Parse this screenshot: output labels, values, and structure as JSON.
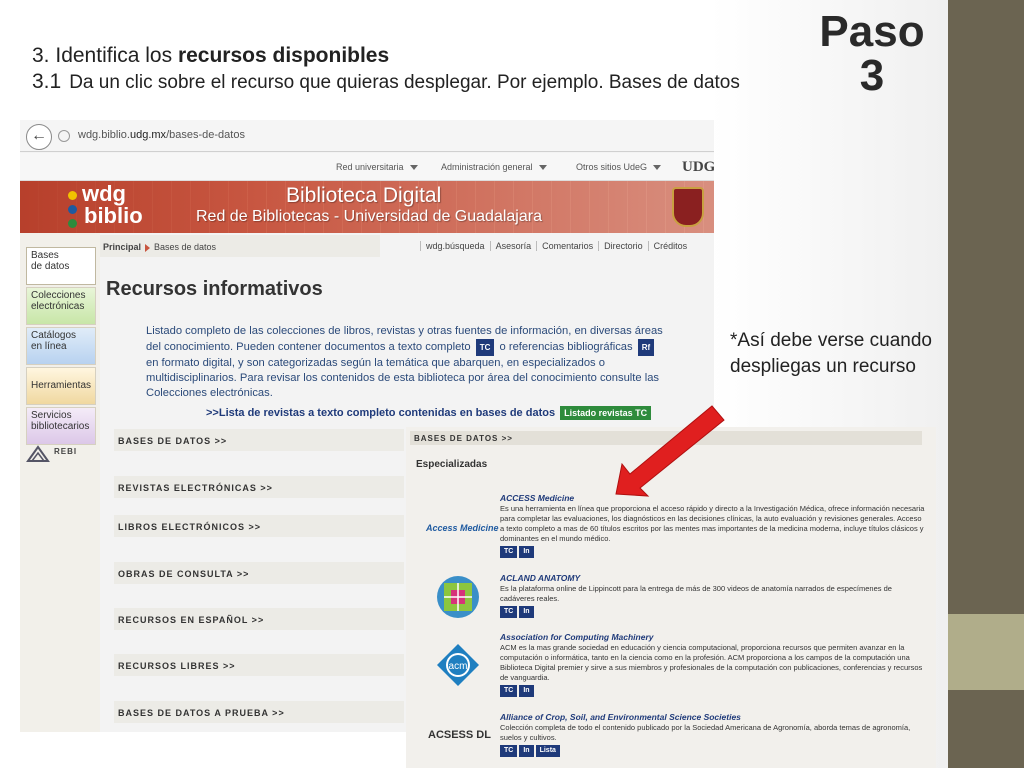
{
  "slide": {
    "paso_label": "Paso",
    "paso_number": "3",
    "step1_number": "3.",
    "step1_prefix": "Identifica los ",
    "step1_bold": "recursos disponibles",
    "step2_number": "3.1",
    "step2_text": "Da un clic sobre el recurso que quieras desplegar. Por ejemplo. Bases de datos",
    "note_text": "*Así debe verse cuando despliegas un recurso",
    "colors": {
      "band_dark": "#6b6451",
      "band_light": "#b0ad8a",
      "arrow": "#e01f1f"
    }
  },
  "browser": {
    "back_icon": "back-arrow-icon",
    "url_host": "wdg.biblio.",
    "url_domain": "udg.mx",
    "url_path": "/bases-de-datos",
    "top_nav": [
      "Red universitaria",
      "Administración general",
      "Otros sitios UdeG"
    ],
    "udg_logo": "UDG",
    "banner_logo_line1": "wdg",
    "banner_logo_line2": "biblio",
    "banner_title": "Biblioteca Digital",
    "banner_subtitle": "Red de Bibliotecas - Universidad de Guadalajara",
    "sidebar": [
      {
        "label": "Bases\nde datos"
      },
      {
        "label": "Colecciones\nelectrónicas"
      },
      {
        "label": "Catálogos\nen línea"
      },
      {
        "label": "Herramientas"
      },
      {
        "label": "Servicios\nbibliotecarios"
      }
    ],
    "rebi_label": "REBI",
    "breadcrumb_home": "Principal",
    "breadcrumb_current": "Bases de datos",
    "util_links": [
      "wdg.búsqueda",
      "Asesoría",
      "Comentarios",
      "Directorio",
      "Créditos"
    ],
    "page_title": "Recursos informativos",
    "intro_part1": "Listado completo de las colecciones de libros, revistas y otras fuentes de información, en diversas áreas del conocimiento. Pueden contener documentos a texto completo",
    "intro_tc": "TC",
    "intro_part2": "o referencias bibliográficas",
    "intro_rf": "Rf",
    "intro_part3": "en formato digital, y son categorizadas según la temática que abarquen, en especializados o multidisciplinarios. Para revisar los contenidos de esta biblioteca por área del conocimiento consulte las Colecciones electrónicas.",
    "journals_link": ">>Lista de revistas a texto completo contenidas en bases de datos",
    "journals_btn": "Listado revistas TC",
    "categories": [
      "BASES DE DATOS >>",
      "REVISTAS ELECTRÓNICAS >>",
      "LIBROS ELECTRÓNICOS >>",
      "OBRAS DE CONSULTA >>",
      "RECURSOS EN ESPAÑOL >>",
      "RECURSOS LIBRES >>",
      "BASES DE DATOS A PRUEBA >>"
    ]
  },
  "panel": {
    "header": "BASES DE DATOS >>",
    "subheader": "Especializadas",
    "entries": [
      {
        "logo": "Access Medicine",
        "title": "ACCESS Medicine",
        "desc": "Es una herramienta en línea que proporciona el acceso rápido y directo a la Investigación Médica, ofrece información necesaria para completar las evaluaciones, los diagnósticos en las decisiones clínicas, la auto evaluación y revisiones generales. Acceso a texto completo a mas de 60 títulos escritos por las mentes mas importantes de la medicina moderna, incluye títulos clásicos y dominantes en el mundo médico.",
        "badges": [
          "TC",
          "In"
        ]
      },
      {
        "logo": "acland-logo",
        "title": "ACLAND ANATOMY",
        "desc": "Es la plataforma online de Lippincott para la entrega de más de 300 videos de anatomía narrados de especímenes de cadáveres reales.",
        "badges": [
          "TC",
          "In"
        ]
      },
      {
        "logo": "acm",
        "title": "Association for Computing Machinery",
        "desc": "ACM es la mas grande sociedad en educación y ciencia computacional, proporciona recursos que permiten avanzar en la computación o informática, tanto en la ciencia como en la profesión. ACM proporciona a los campos de la computación una Biblioteca Digital premier y sirve a sus miembros y profesionales de la computación con publicaciones, conferencias y recursos de vanguardia.",
        "badges": [
          "TC",
          "In"
        ]
      },
      {
        "logo": "ACSESS DL",
        "title": "Alliance of Crop, Soil, and Environmental Science Societies",
        "desc": "Colección completa de todo el contenido publicado por la Sociedad Americana de Agronomía, aborda temas de agronomía, suelos y cultivos.",
        "badges": [
          "TC",
          "In",
          "Lista"
        ]
      }
    ]
  }
}
